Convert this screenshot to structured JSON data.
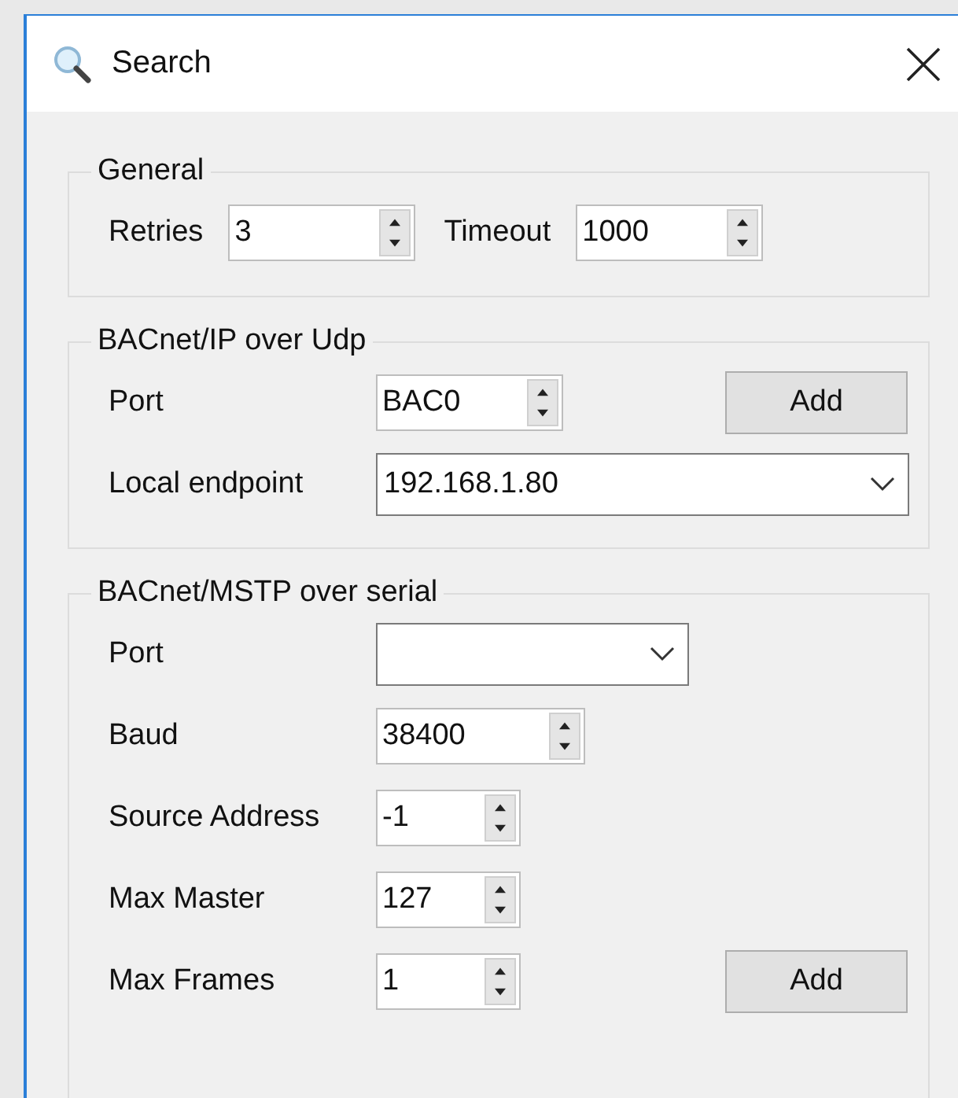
{
  "window": {
    "title": "Search"
  },
  "groups": [
    {
      "title": "General",
      "kind": "inline",
      "rows": [
        {
          "fields": [
            {
              "label": "Retries",
              "kind": "spinner",
              "value": "3"
            },
            {
              "label": "Timeout",
              "kind": "spinner",
              "value": "1000"
            }
          ]
        }
      ]
    },
    {
      "title": "BACnet/IP over Udp",
      "kind": "form",
      "rows": [
        {
          "fields": [
            {
              "label": "Port",
              "kind": "spinner",
              "value": "BAC0"
            }
          ],
          "button": "Add"
        },
        {
          "fields": [
            {
              "label": "Local endpoint",
              "kind": "combo",
              "value": "192.168.1.80"
            }
          ]
        }
      ]
    },
    {
      "title": "BACnet/MSTP over serial",
      "kind": "form",
      "rows": [
        {
          "fields": [
            {
              "label": "Port",
              "kind": "combo"
            }
          ]
        },
        {
          "fields": [
            {
              "label": "Baud",
              "kind": "spinner",
              "value": "38400"
            }
          ]
        },
        {
          "fields": [
            {
              "label": "Source Address",
              "kind": "spinner",
              "value": "-1"
            }
          ]
        },
        {
          "fields": [
            {
              "label": "Max Master",
              "kind": "spinner",
              "value": "127"
            }
          ]
        },
        {
          "fields": [
            {
              "label": "Max Frames",
              "kind": "spinner",
              "value": "1"
            }
          ],
          "button": "Add"
        }
      ]
    }
  ]
}
